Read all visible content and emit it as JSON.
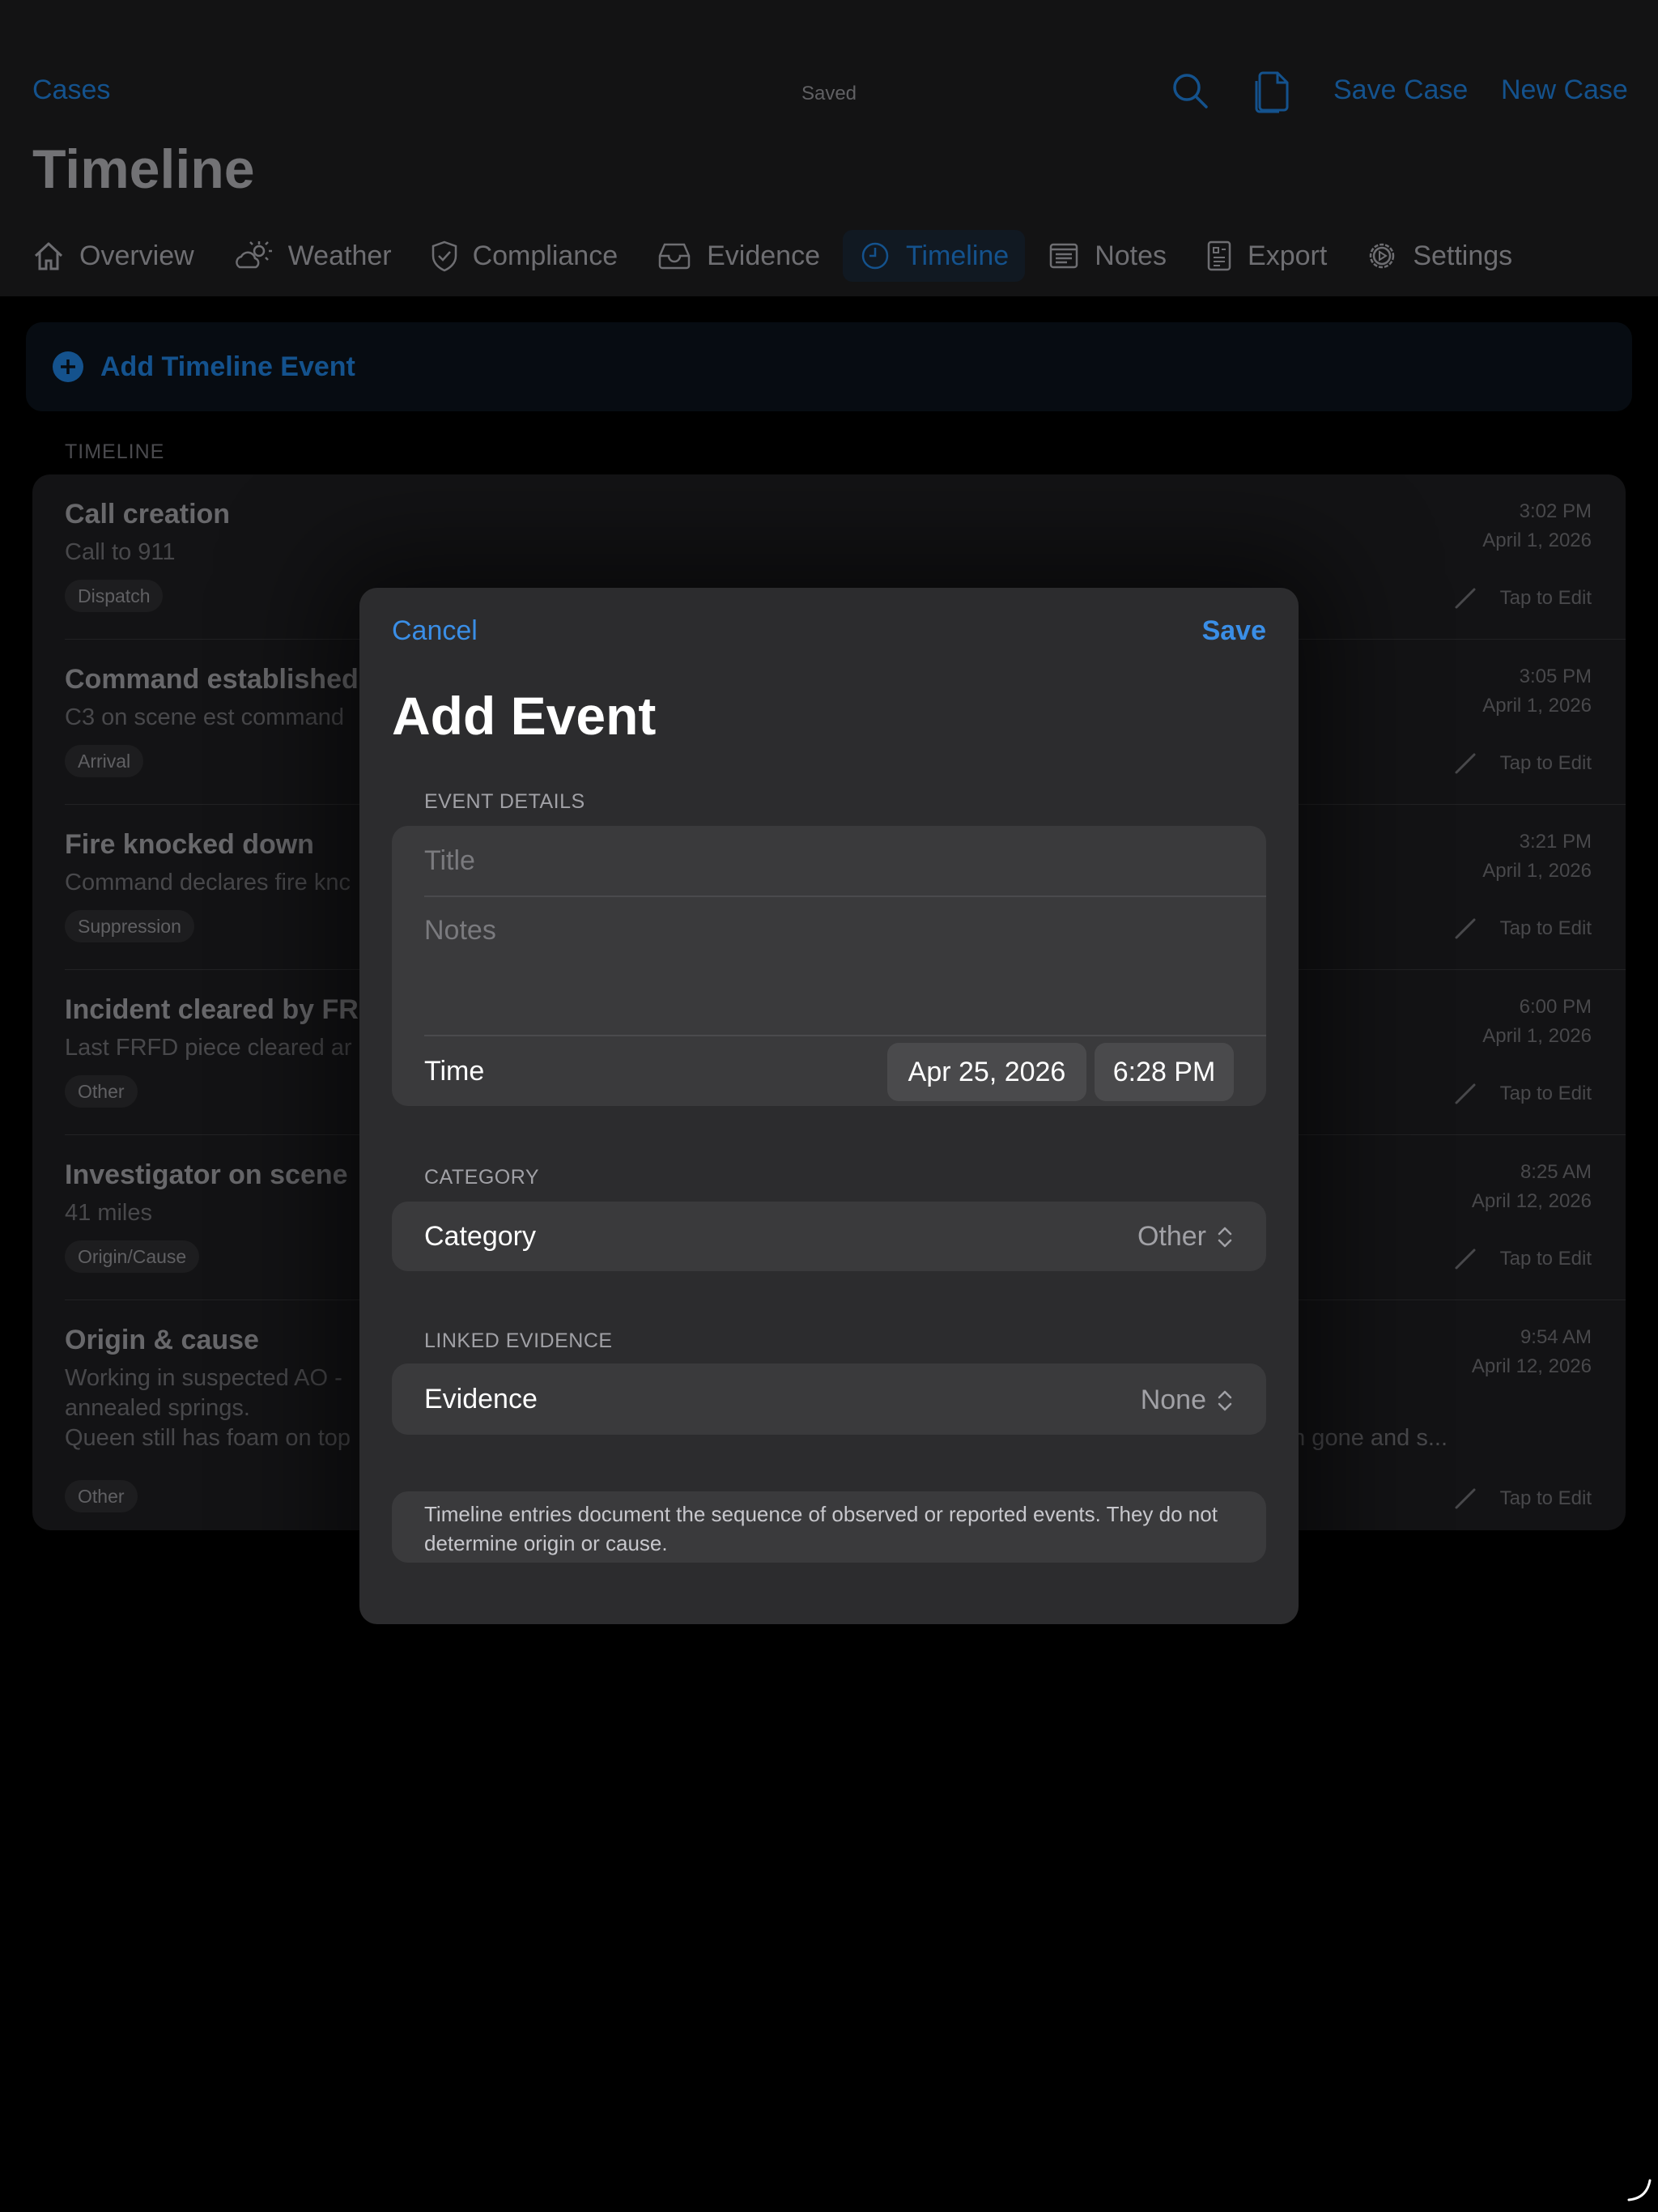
{
  "nav": {
    "back_label": "Cases",
    "status": "Saved",
    "save_case_label": "Save Case",
    "new_case_label": "New Case"
  },
  "page_title": "Timeline",
  "tabs": [
    {
      "label": "Overview",
      "icon": "house-icon"
    },
    {
      "label": "Weather",
      "icon": "cloud-sun-icon"
    },
    {
      "label": "Compliance",
      "icon": "shield-check-icon"
    },
    {
      "label": "Evidence",
      "icon": "tray-icon"
    },
    {
      "label": "Timeline",
      "icon": "clock-icon",
      "active": true
    },
    {
      "label": "Notes",
      "icon": "notes-icon"
    },
    {
      "label": "Export",
      "icon": "export-doc-icon"
    },
    {
      "label": "Settings",
      "icon": "gear-icon"
    }
  ],
  "add_event_label": "Add Timeline Event",
  "timeline_section_header": "TIMELINE",
  "timeline": [
    {
      "title": "Call creation",
      "notes": "Call to 911",
      "category": "Dispatch",
      "time": "3:02 PM",
      "date": "April 1, 2026",
      "edit_label": "Tap to Edit"
    },
    {
      "title": "Command established",
      "notes": "C3 on scene est command",
      "category": "Arrival",
      "time": "3:05 PM",
      "date": "April 1, 2026",
      "edit_label": "Tap to Edit"
    },
    {
      "title": "Fire knocked down",
      "notes": "Command declares fire knc",
      "category": "Suppression",
      "time": "3:21 PM",
      "date": "April 1, 2026",
      "edit_label": "Tap to Edit"
    },
    {
      "title": "Incident cleared by FRF",
      "notes": "Last FRFD piece cleared ar",
      "category": "Other",
      "time": "6:00 PM",
      "date": "April 1, 2026",
      "edit_label": "Tap to Edit"
    },
    {
      "title": "Investigator on scene",
      "notes": "41 miles",
      "category": "Origin/Cause",
      "time": "8:25 AM",
      "date": "April 12, 2026",
      "edit_label": "Tap to Edit"
    },
    {
      "title": "Origin & cause",
      "notes": "Working in suspected AO -",
      "notes_line2": "annealed springs.",
      "notes_line3": "Queen still has foam on top",
      "notes_tail": "n gone and s...",
      "category": "Other",
      "time": "9:54 AM",
      "date": "April 12, 2026",
      "edit_label": "Tap to Edit"
    }
  ],
  "sheet": {
    "cancel_label": "Cancel",
    "save_label": "Save",
    "title": "Add Event",
    "details_header": "EVENT DETAILS",
    "title_placeholder": "Title",
    "notes_placeholder": "Notes",
    "time_label": "Time",
    "date_value": "Apr 25, 2026",
    "time_value": "6:28 PM",
    "category_header": "CATEGORY",
    "category_label": "Category",
    "category_value": "Other",
    "evidence_header": "LINKED EVIDENCE",
    "evidence_label": "Evidence",
    "evidence_value": "None",
    "footnote": "Timeline entries document the sequence of observed or reported events. They do not determine origin or cause."
  }
}
